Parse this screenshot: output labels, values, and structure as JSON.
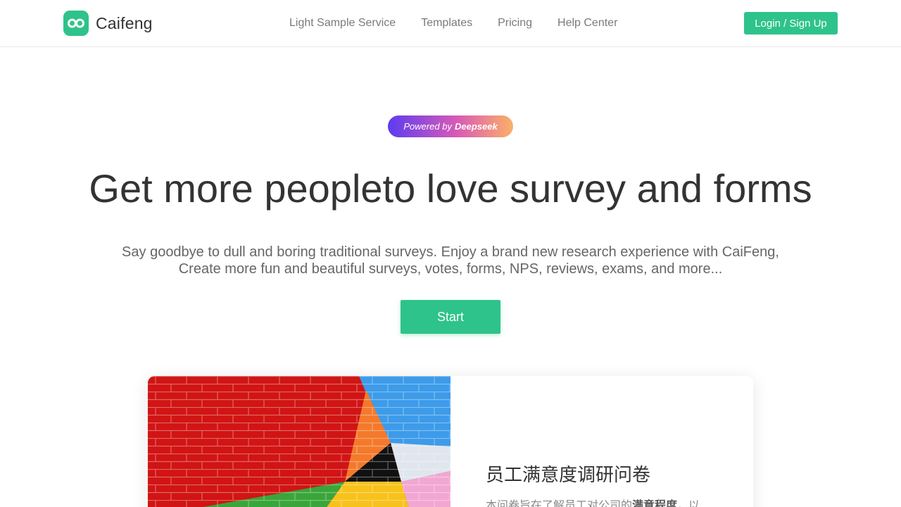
{
  "brand": {
    "name": "Caifeng",
    "logo_icon": "infinity-icon",
    "accent": "#2ec38a"
  },
  "nav": {
    "items": [
      {
        "label": "Light Sample Service"
      },
      {
        "label": "Templates"
      },
      {
        "label": "Pricing"
      },
      {
        "label": "Help Center"
      }
    ],
    "login_label": "Login / Sign Up"
  },
  "hero": {
    "badge_prefix": "Powered by",
    "badge_brand": "Deepseek",
    "title": "Get more peopleto love survey and forms",
    "subtitle_line1": "Say goodbye to dull and boring traditional surveys. Enjoy a brand new research experience with CaiFeng,",
    "subtitle_line2": "Create more fun and beautiful surveys, votes, forms, NPS, reviews, exams, and more...",
    "start_label": "Start"
  },
  "card": {
    "image_icon": "colorful-brick-wall-image",
    "title": "员工满意度调研问卷",
    "desc_prefix": "本问卷旨在了解员工对公司的",
    "desc_bold": "满意程度",
    "desc_suffix": "，以"
  }
}
